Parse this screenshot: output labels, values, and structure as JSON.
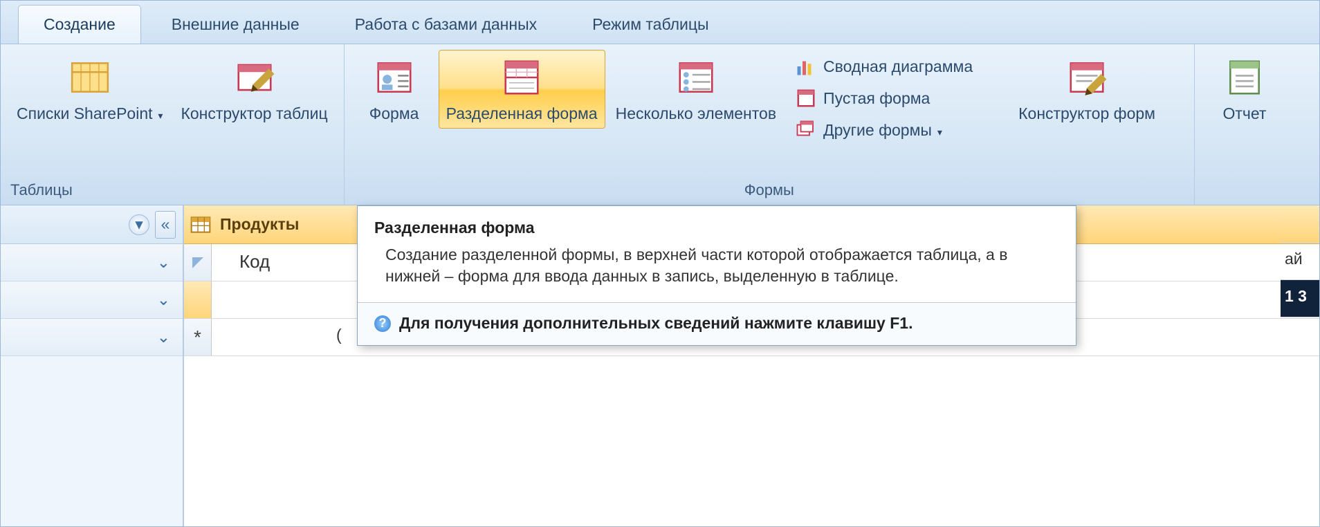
{
  "tabs": {
    "create": "Создание",
    "external": "Внешние данные",
    "database": "Работа с базами данных",
    "datasheet": "Режим таблицы"
  },
  "ribbon": {
    "groups": {
      "tables_label": "Таблицы",
      "forms_label": "Формы"
    },
    "sharepoint": "Списки SharePoint",
    "table_designer": "Конструктор таблиц",
    "form": "Форма",
    "split_form": "Разделенная форма",
    "multiple_items": "Несколько элементов",
    "pivot_chart": "Сводная диаграмма",
    "blank_form": "Пустая форма",
    "more_forms": "Другие формы",
    "form_designer": "Конструктор форм",
    "report": "Отчет"
  },
  "doc": {
    "tab_title": "Продукты",
    "col_code": "Код",
    "new_row_marker": "*",
    "paren": "("
  },
  "tooltip": {
    "title": "Разделенная форма",
    "body": "Создание разделенной формы, в верхней части которой отображается таблица, а в нижней – форма для ввода данных в запись, выделенную в таблице.",
    "footer": "Для получения дополнительных сведений нажмите клавишу F1."
  },
  "edge": {
    "r1": "ай",
    "r2": "1 3"
  }
}
